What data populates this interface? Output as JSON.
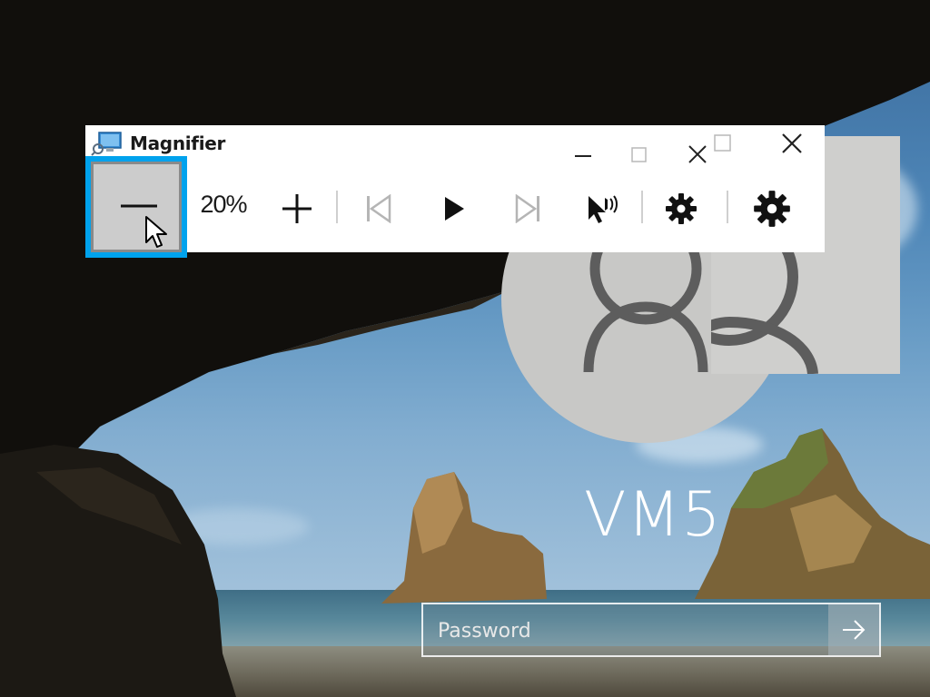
{
  "lock_screen": {
    "machine_name": "VM5",
    "password_placeholder": "Password",
    "submit_icon": "arrow-right-icon",
    "avatar_icon": "user-avatar-icon"
  },
  "magnifier": {
    "title": "Magnifier",
    "app_icon": "magnifier-app-icon",
    "zoom_level": "20%",
    "controls": {
      "zoom_out": "minus-icon",
      "zoom_in": "plus-icon",
      "previous": "skip-previous-icon",
      "play": "play-icon",
      "next": "skip-next-icon",
      "read_from_pointer": "read-from-pointer-icon",
      "settings": "gear-icon"
    },
    "caption_buttons": [
      "minimize-icon",
      "maximize-icon",
      "close-icon"
    ]
  },
  "colors": {
    "focus_highlight": "#00a2ed",
    "window_background": "#ffffff",
    "disabled_icon": "#b5b5b5"
  }
}
